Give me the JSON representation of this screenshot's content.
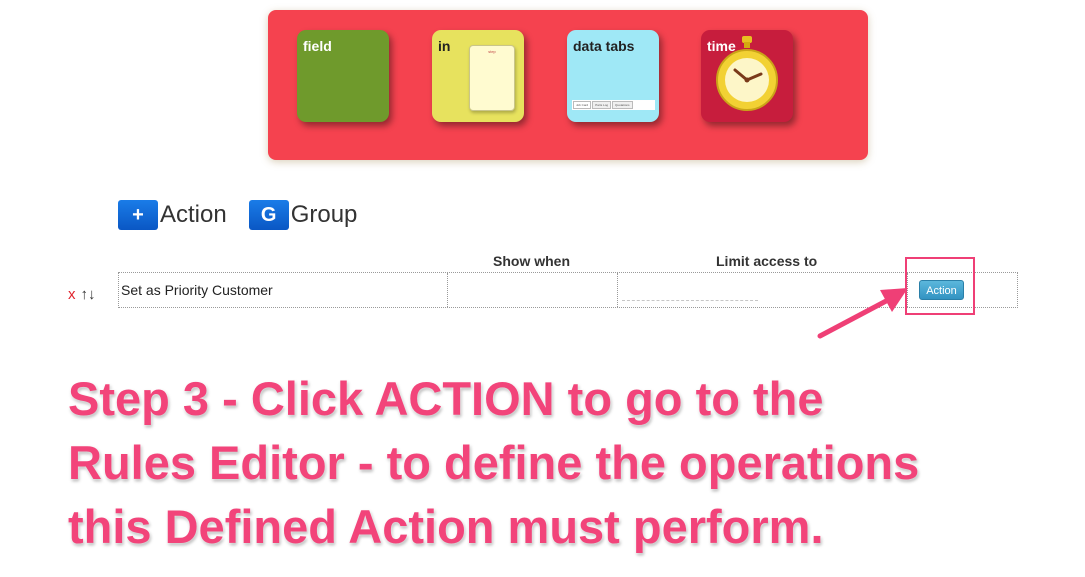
{
  "toolbox": {
    "tiles": [
      {
        "label": "field"
      },
      {
        "label": "in",
        "paper_word": "step"
      },
      {
        "label": "data tabs",
        "mini_tabs": [
          "Job Card",
          "Parts Log",
          "Quotations"
        ]
      },
      {
        "label": "time"
      }
    ]
  },
  "add_bar": {
    "action_badge": "+",
    "action_label": "Action",
    "group_badge": "G",
    "group_label": "Group"
  },
  "table": {
    "columns": [
      "Show when",
      "Limit access to"
    ],
    "rows": [
      {
        "name": "Set as Priority Customer",
        "button_label": "Action"
      }
    ]
  },
  "row_controls": {
    "delete": "x",
    "up": "↑",
    "down": "↓"
  },
  "annotation": {
    "lines": [
      "Step 3 - Click ACTION to go to the",
      "Rules Editor - to define the operations",
      "this Defined Action must perform."
    ],
    "color": "#f2447a"
  },
  "colors": {
    "toolbox_bg": "#f5424f",
    "field_tile": "#6f9a2c",
    "in_tile": "#e7e25e",
    "tabs_tile": "#9fe8f6",
    "time_tile": "#c71d3d",
    "highlight": "#ef3f76"
  },
  "icons": [
    "plus-icon",
    "group-icon",
    "stopwatch-icon",
    "paper-icon",
    "arrow-up-icon",
    "arrow-down-icon",
    "pointer-arrow-icon"
  ]
}
